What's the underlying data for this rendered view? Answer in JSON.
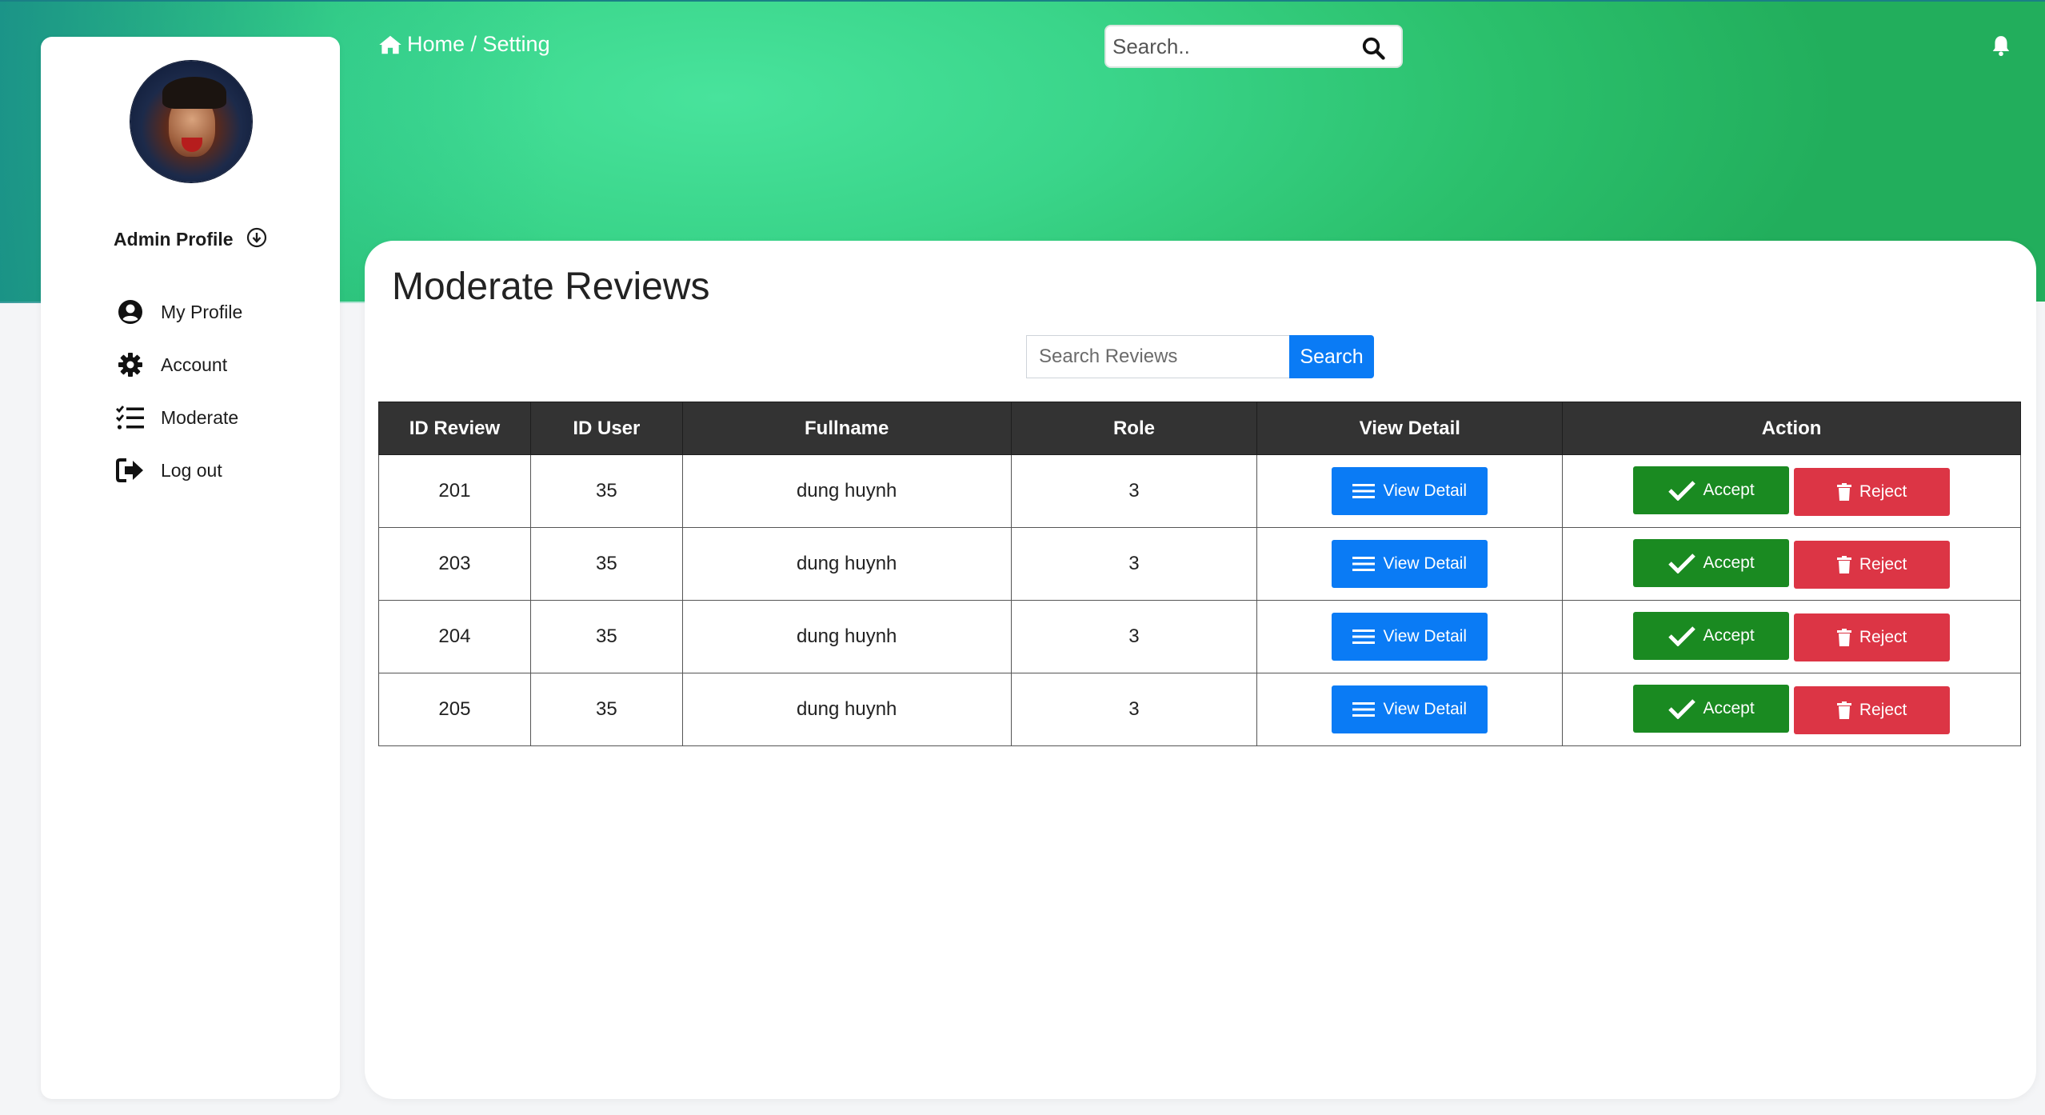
{
  "sidebar": {
    "profile_name": "Admin Profile",
    "items": [
      {
        "label": "My Profile",
        "icon": "user-circle-icon"
      },
      {
        "label": "Account",
        "icon": "gear-icon"
      },
      {
        "label": "Moderate",
        "icon": "checklist-icon"
      },
      {
        "label": "Log out",
        "icon": "logout-icon"
      }
    ]
  },
  "header": {
    "breadcrumb": "Home / Setting",
    "search_placeholder": "Search..",
    "accent": "#2bc06c"
  },
  "main": {
    "title": "Moderate Reviews",
    "search_placeholder": "Search Reviews",
    "search_button": "Search",
    "columns": [
      "ID Review",
      "ID User",
      "Fullname",
      "Role",
      "View Detail",
      "Action"
    ],
    "rows": [
      {
        "id_review": "201",
        "id_user": "35",
        "fullname": "dung huynh",
        "role": "3"
      },
      {
        "id_review": "203",
        "id_user": "35",
        "fullname": "dung huynh",
        "role": "3"
      },
      {
        "id_review": "204",
        "id_user": "35",
        "fullname": "dung huynh",
        "role": "3"
      },
      {
        "id_review": "205",
        "id_user": "35",
        "fullname": "dung huynh",
        "role": "3"
      }
    ],
    "view_label": "View Detail",
    "accept_label": "Accept",
    "reject_label": "Reject"
  }
}
